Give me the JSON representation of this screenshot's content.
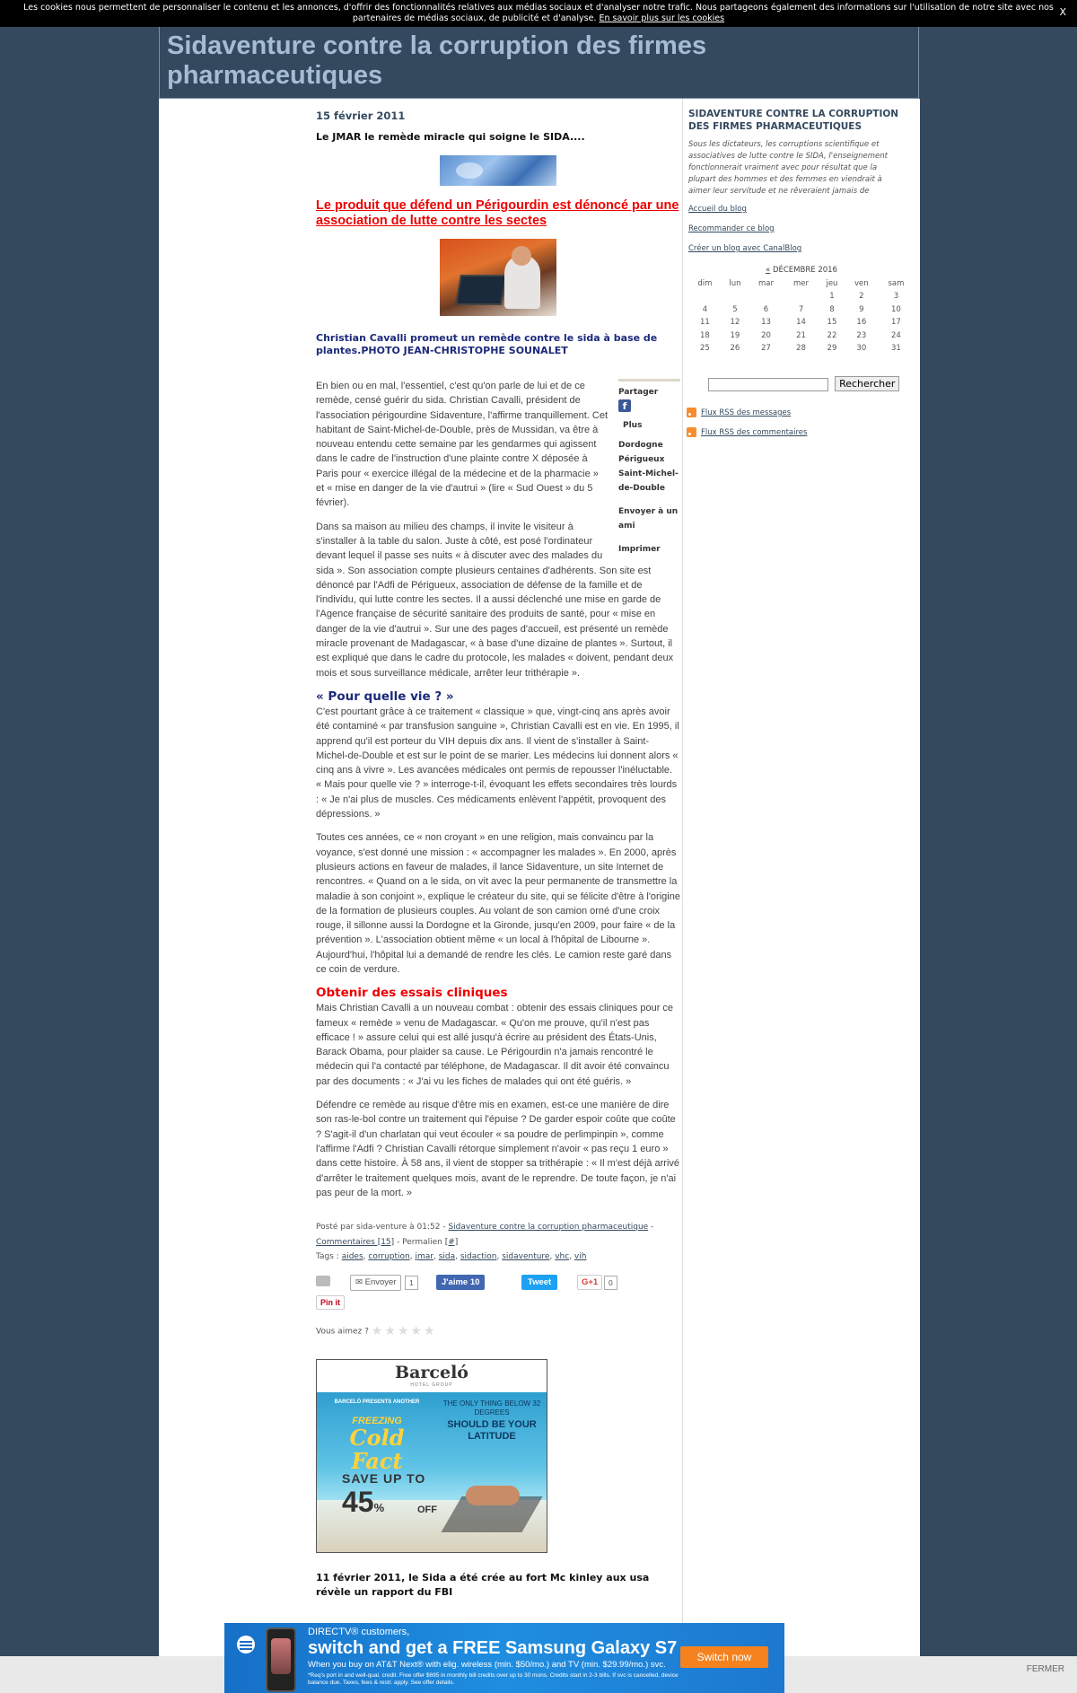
{
  "cookie_bar": {
    "text": "Les cookies nous permettent de personnaliser le contenu et les annonces, d'offrir des fonctionnalités relatives aux médias sociaux et d'analyser notre trafic. Nous partageons également des informations sur l'utilisation de notre site avec nos partenaires de médias sociaux, de publicité et d'analyse.",
    "link": "En savoir plus sur les cookies",
    "close": "X"
  },
  "blog": {
    "title": "Sidaventure contre la corruption des firmes pharmaceutiques"
  },
  "post": {
    "date": "15 février 2011",
    "title": "Le JMAR le remède miracle qui soigne le SIDA....",
    "headline_link": "Le produit que défend un Périgourdin est dénoncé par une association de lutte contre les sectes",
    "caption": "Christian Cavalli promeut un remède contre le sida à base de plantes.PHOTO JEAN-CHRISTOPHE SOUNALET",
    "share": {
      "partager": "Partager",
      "plus": "Plus",
      "tags": [
        "Dordogne",
        "Périgueux",
        "Saint-Michel-de-Double"
      ],
      "send_friend": "Envoyer à un ami",
      "print": "Imprimer"
    },
    "paragraphs1": [
      "En bien ou en mal, l'essentiel, c'est qu'on parle de lui et de ce remède, censé guérir du sida. Christian Cavalli, président de l'association périgourdine Sidaventure, l'affirme tranquillement. Cet habitant de Saint-Michel-de-Double, près de Mussidan, va être à nouveau entendu cette semaine par les gendarmes qui agissent dans le cadre de l'instruction d'une plainte contre X déposée à Paris pour « exercice illégal de la médecine et de la pharmacie » et « mise en danger de la vie d'autrui » (lire « Sud Ouest » du 5 février).",
      "Dans sa maison au milieu des champs, il invite le visiteur à s'installer à la table du salon. Juste à côté, est posé l'ordinateur devant lequel il passe ses nuits « à discuter avec des malades du sida ». Son association compte plusieurs centaines d'adhérents. Son site est dénoncé par l'Adfi de Périgueux, association de défense de la famille et de l'individu, qui lutte contre les sectes. Il a aussi déclenché une mise en garde de l'Agence française de sécurité sanitaire des produits de santé, pour « mise en danger de la vie d'autrui ». Sur une des pages d'accueil, est présenté un remède miracle provenant de Madagascar, « à base d'une dizaine de plantes ». Surtout, il est expliqué que dans le cadre du protocole, les malades « doivent, pendant deux mois et sous surveillance médicale, arrêter leur trithérapie »."
    ],
    "subhead1": "« Pour quelle vie ? »",
    "paragraphs2": [
      "C'est pourtant grâce à ce traitement « classique » que, vingt-cinq ans après avoir été contaminé « par transfusion sanguine », Christian Cavalli est en vie. En 1995, il apprend qu'il est porteur du VIH depuis dix ans. Il vient de s'installer à Saint-Michel-de-Double et est sur le point de se marier. Les médecins lui donnent alors « cinq ans à vivre ». Les avancées médicales ont permis de repousser l'inéluctable. « Mais pour quelle vie ? » interroge-t-il, évoquant les effets secondaires très lourds : « Je n'ai plus de muscles. Ces médicaments enlèvent l'appétit, provoquent des dépressions. »",
      "Toutes ces années, ce « non croyant » en une religion, mais convaincu par la voyance, s'est donné une mission : « accompagner les malades ». En 2000, après plusieurs actions en faveur de malades, il lance Sidaventure, un site Internet de rencontres. « Quand on a le sida, on vit avec la peur permanente de transmettre la maladie à son conjoint », explique le créateur du site, qui se félicite d'être à l'origine de la formation de plusieurs couples. Au volant de son camion orné d'une croix rouge, il sillonne aussi la Dordogne et la Gironde, jusqu'en 2009, pour faire « de la prévention ». L'association obtient même « un local à l'hôpital de Libourne ». Aujourd'hui, l'hôpital lui a demandé de rendre les clés. Le camion reste garé dans ce coin de verdure."
    ],
    "subhead2": "Obtenir des essais cliniques",
    "paragraphs3": [
      "Mais Christian Cavalli a un nouveau combat : obtenir des essais cliniques pour ce fameux « remède » venu de Madagascar. « Qu'on me prouve, qu'il n'est pas efficace ! » assure celui qui est allé jusqu'à écrire au président des États-Unis, Barack Obama, pour plaider sa cause. Le Périgourdin n'a jamais rencontré le médecin qui l'a contacté par téléphone, de Madagascar. Il dit avoir été convaincu par des documents : « J'ai vu les fiches de malades qui ont été guéris. »",
      "Défendre ce remède au risque d'être mis en examen, est-ce une manière de dire son ras-le-bol contre un traitement qui l'épuise ? De garder espoir coûte que coûte ? S'agit-il d'un charlatan qui veut écouler « sa poudre de perlimpinpin », comme l'affirme l'Adfi ? Christian Cavalli rétorque simplement n'avoir « pas reçu 1 euro » dans cette histoire. À 58 ans, il vient de stopper sa trithérapie : « Il m'est déjà arrivé d'arrêter le traitement quelques mois, avant de le reprendre. De toute façon, je n'ai pas peur de la mort. »"
    ],
    "meta": {
      "posted": "Posté par sida-venture à 01:52 - ",
      "category": "Sidaventure contre la corruption pharmaceutique",
      "sep": " - ",
      "comments": "Commentaires [15]",
      "permalien": " - Permalien ",
      "hash": "[#]",
      "tags_label": "Tags : ",
      "tags": [
        "aides",
        "corruption",
        "jmar",
        "sida",
        "sidaction",
        "sidaventure",
        "vhc",
        "vih"
      ]
    },
    "social": {
      "envoyer": "Envoyer",
      "envoyer_count": "1",
      "fb": "J'aime 10",
      "tweet": "Tweet",
      "gplus": "G+1",
      "gplus_count": "0",
      "pin": "Pin it"
    },
    "rating_label": "Vous aimez ?"
  },
  "ad": {
    "brand": "Barceló",
    "brand_sub": "HOTEL GROUP",
    "presents": "BARCELÓ PRESENTS ANOTHER",
    "freezing": "FREEZING",
    "cold_fact": "Cold Fact",
    "right1": "THE ONLY THING BELOW 32 DEGREES",
    "right2": "SHOULD BE YOUR LATITUDE",
    "save": "SAVE UP TO",
    "pct": "45",
    "pct_sign": "%",
    "off": "OFF"
  },
  "next_post": {
    "title": "11 février 2011, le Sida a été crée au fort Mc kinley aux usa révèle un rapport du FBI"
  },
  "sidebar": {
    "title": "SIDAVENTURE CONTRE LA CORRUPTION DES FIRMES PHARMACEUTIQUES",
    "desc": "Sous les dictateurs, les corruptions scientifique et associatives de lutte contre le SIDA, l'enseignement fonctionnerait vraiment avec pour résultat que la plupart des hommes et des femmes en viendrait à aimer leur servitude et ne rêveraient jamais de",
    "links": [
      "Accueil du blog",
      "Recommander ce blog",
      "Créer un blog avec CanalBlog"
    ],
    "calendar": {
      "prev": "«",
      "month": " DÉCEMBRE 2016",
      "days": [
        "dim",
        "lun",
        "mar",
        "mer",
        "jeu",
        "ven",
        "sam"
      ],
      "weeks": [
        [
          "",
          "",
          "",
          "",
          "1",
          "2",
          "3"
        ],
        [
          "4",
          "5",
          "6",
          "7",
          "8",
          "9",
          "10"
        ],
        [
          "11",
          "12",
          "13",
          "14",
          "15",
          "16",
          "17"
        ],
        [
          "18",
          "19",
          "20",
          "21",
          "22",
          "23",
          "24"
        ],
        [
          "25",
          "26",
          "27",
          "28",
          "29",
          "30",
          "31"
        ]
      ]
    },
    "search_button": "Rechercher",
    "rss": [
      "Flux RSS des messages",
      "Flux RSS des commentaires"
    ]
  },
  "banner": {
    "line1": "DIRECTV® customers,",
    "line2": "switch and get a FREE Samsung Galaxy S7",
    "line3": "When you buy on AT&T Next® with elig. wireless (min. $50/mo.) and TV (min. $29.99/mo.) svc.",
    "line4": "*Req's port in and well-qual. credit. Free offer $695 in monthly bill credits over up to 30 mons. Credits start in 2-3 bills. If svc is cancelled, device balance due. Taxes, fees & restr. apply. See offer details.",
    "button": "Switch now",
    "close": "FERMER"
  }
}
